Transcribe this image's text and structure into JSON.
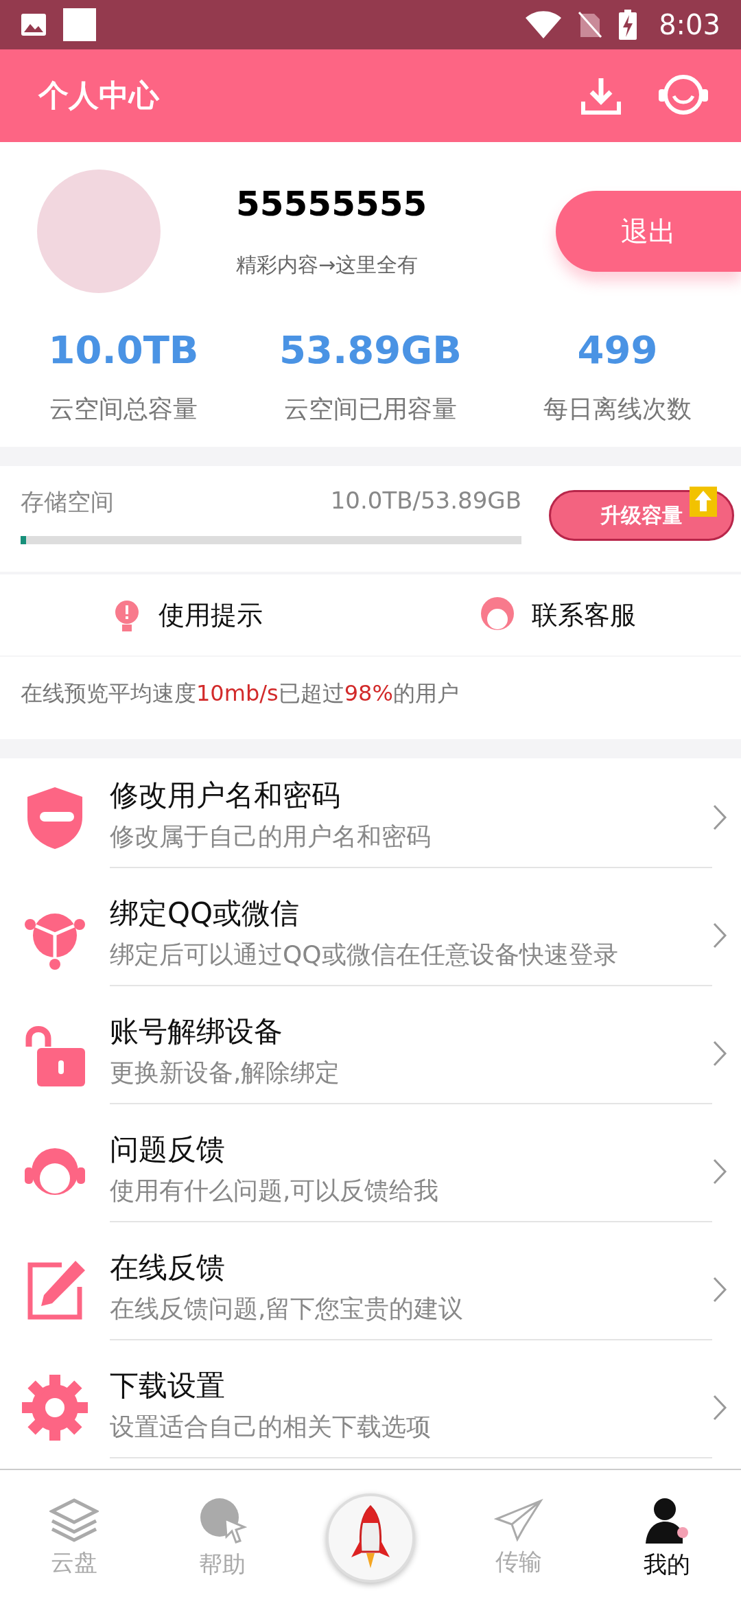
{
  "status_bar": {
    "time": "8:03"
  },
  "header": {
    "title": "个人中心"
  },
  "profile": {
    "username": "55555555",
    "tagline": "精彩内容→这里全有",
    "logout_label": "退出"
  },
  "stats": [
    {
      "value": "10.0TB",
      "label": "云空间总容量"
    },
    {
      "value": "53.89GB",
      "label": "云空间已用容量"
    },
    {
      "value": "499",
      "label": "每日离线次数"
    }
  ],
  "storage": {
    "label": "存储空间",
    "reading": "10.0TB/53.89GB",
    "level": 0.01,
    "upgrade_label": "升级容量"
  },
  "quick_actions": [
    {
      "kind": "tips",
      "label": "使用提示"
    },
    {
      "kind": "service",
      "label": "联系客服"
    }
  ],
  "speed_tip": [
    {
      "text": "在线预览平均速度",
      "highlight": false
    },
    {
      "text": "10mb/s",
      "highlight": true
    },
    {
      "text": "已超过",
      "highlight": false
    },
    {
      "text": "98%",
      "highlight": true
    },
    {
      "text": "的用户",
      "highlight": false
    }
  ],
  "menu": [
    {
      "kind": "shield",
      "title": "修改用户名和密码",
      "subtitle": "修改属于自己的用户名和密码"
    },
    {
      "kind": "share",
      "title": "绑定QQ或微信",
      "subtitle": "绑定后可以通过QQ或微信在任意设备快速登录"
    },
    {
      "kind": "unlock",
      "title": "账号解绑设备",
      "subtitle": "更换新设备,解除绑定"
    },
    {
      "kind": "support",
      "title": "问题反馈",
      "subtitle": "使用有什么问题,可以反馈给我"
    },
    {
      "kind": "edit",
      "title": "在线反馈",
      "subtitle": "在线反馈问题,留下您宝贵的建议"
    },
    {
      "kind": "gear",
      "title": "下载设置",
      "subtitle": "设置适合自己的相关下载选项"
    }
  ],
  "tab_bar": [
    {
      "kind": "layers",
      "label": "云盘",
      "selected": false
    },
    {
      "kind": "globe",
      "label": "帮助",
      "selected": false
    },
    {
      "kind": "rocket"
    },
    {
      "kind": "send",
      "label": "传输",
      "selected": false
    },
    {
      "kind": "person",
      "label": "我的",
      "selected": true
    }
  ]
}
